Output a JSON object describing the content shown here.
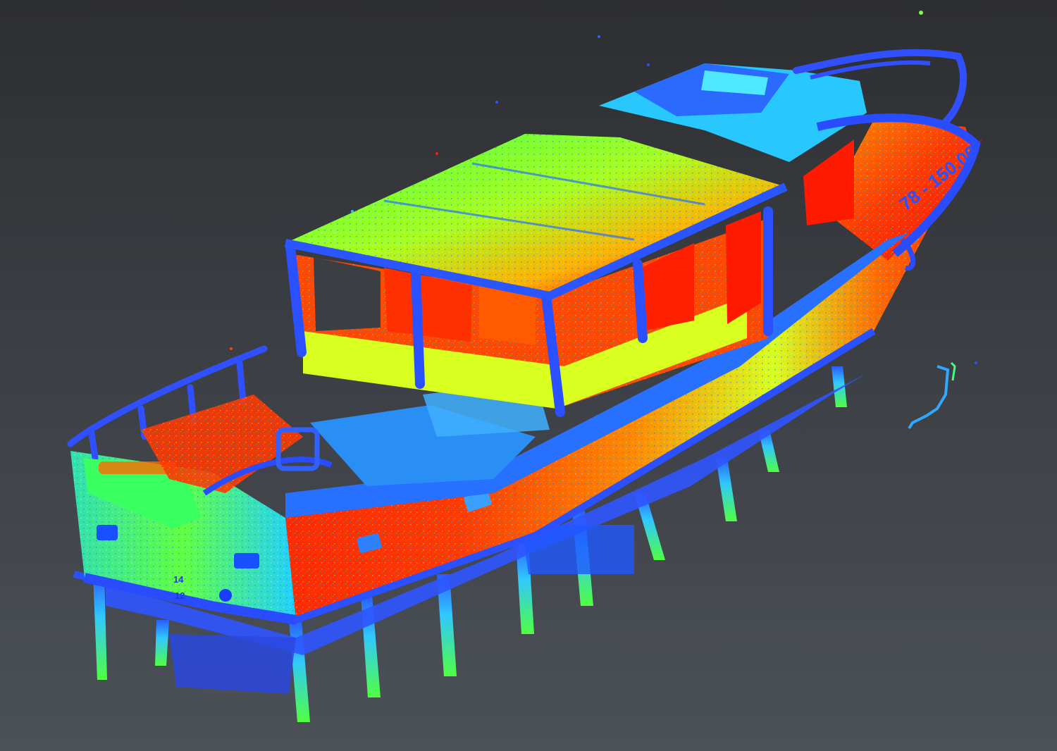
{
  "scene": {
    "subject": "boat-point-cloud",
    "background_colors": [
      "#2d2e31",
      "#3b3e43",
      "#4c5158"
    ],
    "colormap": [
      "#3040ff",
      "#20c0ff",
      "#30ff60",
      "#c0ff20",
      "#ff8800",
      "#ff1a00"
    ]
  },
  "hull_markings": {
    "registration": "78 - 150.00",
    "stern_numbers": [
      "14",
      "12"
    ]
  }
}
